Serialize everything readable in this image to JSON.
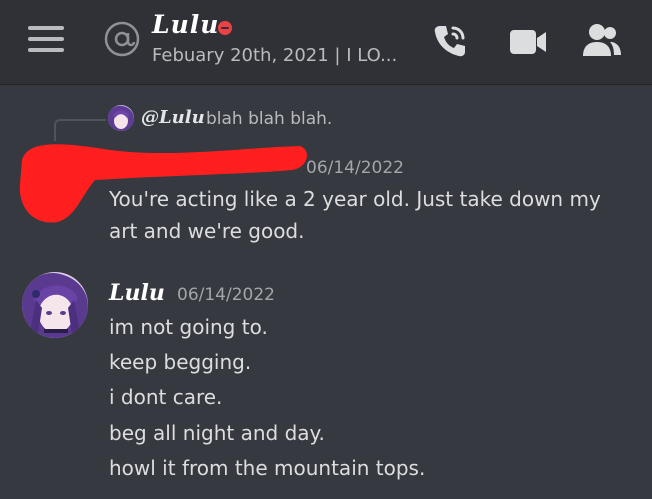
{
  "header": {
    "channel_name": "Lulu",
    "status_text": "Febuary 20th, 2021 | I LO...",
    "icons": [
      "menu-icon",
      "at-icon",
      "phone-call-icon",
      "video-camera-icon",
      "members-icon"
    ]
  },
  "messages": {
    "reply_preview": {
      "author": "@Lulu",
      "text": "blah blah blah."
    },
    "first": {
      "timestamp": "06/14/2022",
      "lines": [
        "You're acting like a 2 year old. Just take down my",
        "art and we're good."
      ]
    },
    "second": {
      "author": "Lulu",
      "timestamp": "06/14/2022",
      "lines": [
        "im not going to.",
        "keep begging.",
        "i dont care.",
        "beg all night and day.",
        "howl it from the mountain tops."
      ]
    }
  },
  "colors": {
    "background": "#36393f",
    "topbar": "#2f3136",
    "dnd": "#ed4245",
    "redaction": "#ff1f1f"
  }
}
